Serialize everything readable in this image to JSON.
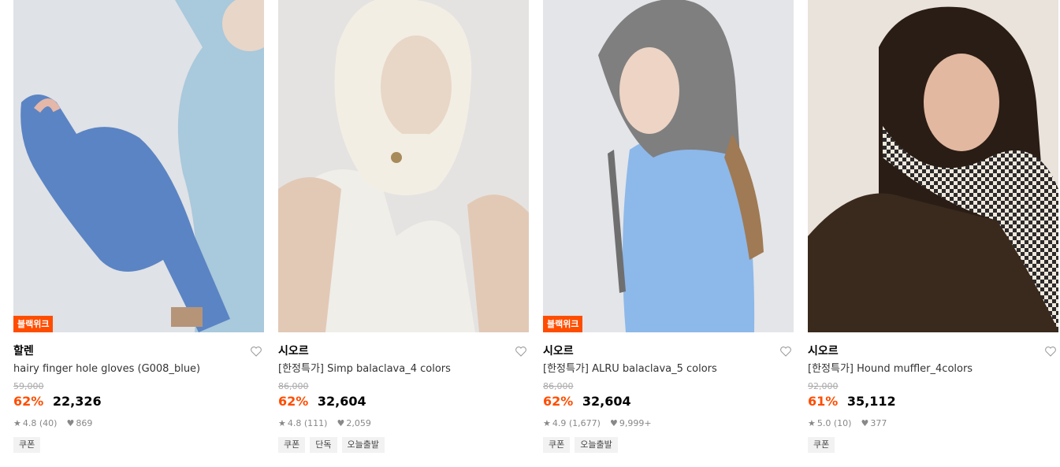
{
  "products": [
    {
      "badge": "블랙위크",
      "brand": "할렌",
      "name": "hairy finger hole gloves (G008_blue)",
      "original_price": "59,000",
      "discount": "62%",
      "price": "22,326",
      "rating": "4.8 (40)",
      "likes": "869",
      "tags": [
        "쿠폰"
      ],
      "colors": {
        "bg": "#dfe2e6",
        "accent": "#5b84c4",
        "accent2": "#a9c9dc"
      }
    },
    {
      "badge": "",
      "brand": "시오르",
      "name": "[한정특가] Simp balaclava_4 colors",
      "original_price": "86,000",
      "discount": "62%",
      "price": "32,604",
      "rating": "4.8 (111)",
      "likes": "2,059",
      "tags": [
        "쿠폰",
        "단독",
        "오늘출발"
      ],
      "colors": {
        "bg": "#e4e3e1",
        "accent": "#f3eee4",
        "accent2": "#e8d7c6"
      }
    },
    {
      "badge": "블랙위크",
      "brand": "시오르",
      "name": "[한정특가] ALRU balaclava_5 colors",
      "original_price": "86,000",
      "discount": "62%",
      "price": "32,604",
      "rating": "4.9 (1,677)",
      "likes": "9,999+",
      "tags": [
        "쿠폰",
        "오늘출발"
      ],
      "colors": {
        "bg": "#e3e5e8",
        "accent": "#7f7f80",
        "accent2": "#8db8ea"
      }
    },
    {
      "badge": "",
      "brand": "시오르",
      "name": "[한정특가] Hound muffler_4colors",
      "original_price": "92,000",
      "discount": "61%",
      "price": "35,112",
      "rating": "5.0 (10)",
      "likes": "377",
      "tags": [
        "쿠폰"
      ],
      "colors": {
        "bg": "#e9e3db",
        "accent": "#3a2a1d",
        "accent2": "#2c2a2b"
      }
    }
  ],
  "icons": {
    "heart": "heart-outline-icon",
    "star": "star-icon",
    "like": "heart-filled-icon"
  },
  "theme": {
    "discount_color": "#ff4d00",
    "badge_color": "#ff4d00"
  }
}
